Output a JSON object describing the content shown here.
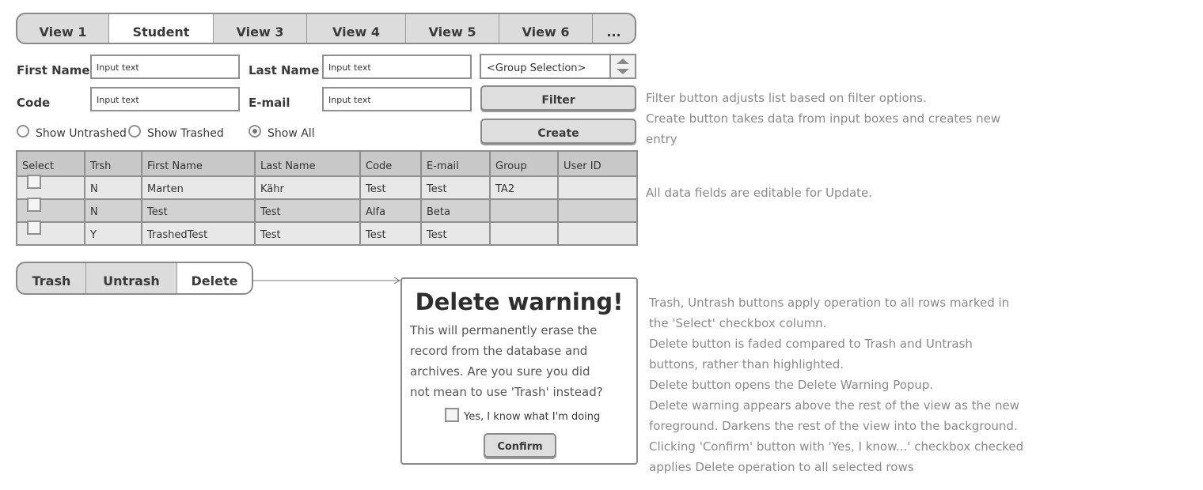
{
  "tabs": [
    {
      "label": "View 1"
    },
    {
      "label": "Student"
    },
    {
      "label": "View 3"
    },
    {
      "label": "View 4"
    },
    {
      "label": "View 5"
    },
    {
      "label": "View 6"
    },
    {
      "label": "..."
    }
  ],
  "form": {
    "first_name_label": "First Name",
    "last_name_label": "Last Name",
    "code_label": "Code",
    "email_label": "E-mail",
    "first_name_value": "Input text",
    "last_name_value": "Input text",
    "code_value": "Input text",
    "email_value": "Input text",
    "group_selection": "<Group Selection>",
    "filter_label": "Filter",
    "create_label": "Create"
  },
  "radios": {
    "untrashed": "Show Untrashed",
    "trashed": "Show Trashed",
    "all": "Show All",
    "selected": "all"
  },
  "table": {
    "headers": [
      "Select",
      "Trsh",
      "First Name",
      "Last Name",
      "Code",
      "E-mail",
      "Group",
      "User ID"
    ],
    "rows": [
      [
        "N",
        "Marten",
        "Kähr",
        "Test",
        "Test",
        "TA2",
        ""
      ],
      [
        "N",
        "Test",
        "Test",
        "Alfa",
        "Beta",
        "",
        ""
      ],
      [
        "Y",
        "TrashedTest",
        "Test",
        "Test",
        "Test",
        "",
        ""
      ]
    ]
  },
  "actions": {
    "trash": "Trash",
    "untrash": "Untrash",
    "delete": "Delete"
  },
  "popup": {
    "title": "Delete warning!",
    "body": "This will permanently erase the record from the database and archives. Are you sure you did not mean to use 'Trash' instead?",
    "checkbox_label": "Yes, I know what I'm doing",
    "confirm_label": "Confirm"
  },
  "notes": {
    "filter": "Filter button adjusts list based on filter options.",
    "create_line1": "Create button takes data from input boxes and creates new",
    "create_line2": "entry",
    "editable": "All data fields are editable for Update.",
    "n1": "Trash, Untrash buttons apply operation to all rows marked in",
    "n2": "the 'Select' checkbox column.",
    "n3": "Delete button is faded compared to Trash and Untrash",
    "n4": "buttons, rather than highlighted.",
    "n5": "Delete button opens the Delete Warning Popup.",
    "n6": "Delete warning appears above the rest of the view as the new",
    "n7": "foreground. Darkens the rest of the view into the background.",
    "n8": "Clicking 'Confirm' button with 'Yes, I know...' checkbox checked",
    "n9": "applies Delete operation to all selected rows"
  }
}
